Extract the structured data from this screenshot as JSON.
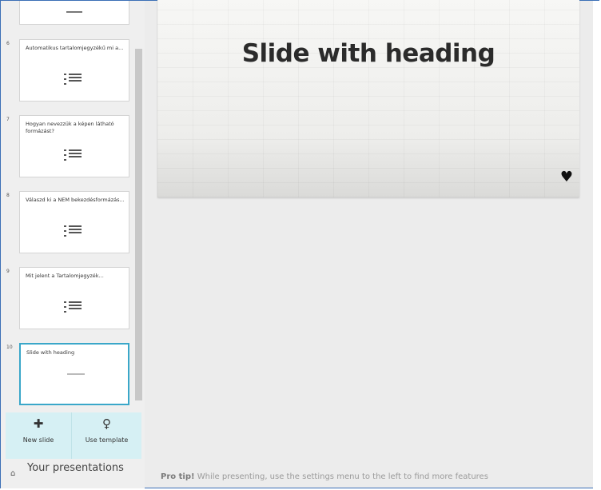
{
  "slides": [
    {
      "number": "6",
      "title": "Automatikus tartalomjegyzékű mi a...",
      "icon": "list-icon"
    },
    {
      "number": "7",
      "title": "Hogyan nevezzük a képen látható formázást?",
      "icon": "list-icon"
    },
    {
      "number": "8",
      "title": "Válaszd ki a NEM bekezdésformázás...",
      "icon": "list-icon"
    },
    {
      "number": "9",
      "title": "Mit jelent a Tartalomjegyzék...",
      "icon": "list-icon"
    },
    {
      "number": "10",
      "title": "Slide with heading",
      "icon": "text-line"
    }
  ],
  "actions": {
    "new_slide": {
      "label": "New slide",
      "icon": "plus-icon"
    },
    "use_template": {
      "label": "Use template",
      "icon": "lightbulb-icon"
    }
  },
  "your_presentations": {
    "label": "Your presentations",
    "icon": "home-icon"
  },
  "current_slide": {
    "heading": "Slide with heading",
    "icon": "heart-icon"
  },
  "protip": {
    "bold": "Pro tip!",
    "text": " While presenting, use the settings menu to the left to find more features"
  },
  "colors": {
    "accent": "#3aa7c9",
    "actions_bg": "#d6f0f4",
    "main_bg": "#ececec"
  }
}
